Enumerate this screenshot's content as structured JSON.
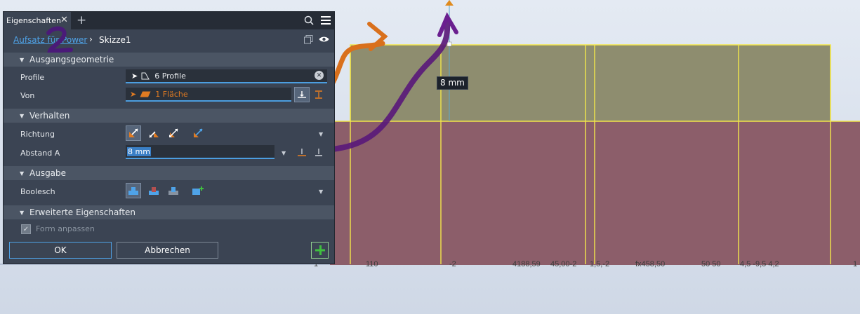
{
  "viewport": {
    "dimension_value": "8 mm",
    "ruler_labels": [
      "1",
      "110",
      "-2",
      "4188,59",
      "45,00-2",
      "1,5,-2",
      "fx458,50",
      "50 50",
      "4,5 -9,5 4,2",
      "1"
    ],
    "colors": {
      "top_block": "#8e8d6f",
      "lower_block": "#8c5e6a",
      "edge_yellow": "#f2e64a",
      "annotation_purple": "#5a1a7a",
      "annotation_orange": "#d9701c"
    },
    "annotations": {
      "number_mark": "2"
    }
  },
  "panel": {
    "tab_title": "Eigenschaften",
    "breadcrumb_link": "Aufsatz für Power",
    "breadcrumb_current": "Skizze1",
    "sections": {
      "source": "Ausgangsgeometrie",
      "behavior": "Verhalten",
      "output": "Ausgabe",
      "advanced": "Erweiterte Eigenschaften"
    },
    "profile": {
      "label": "Profile",
      "value": "6 Profile"
    },
    "from": {
      "label": "Von",
      "value": "1 Fläche"
    },
    "direction": {
      "label": "Richtung"
    },
    "distance": {
      "label": "Abstand A",
      "value": "8 mm"
    },
    "boolean": {
      "label": "Boolesch"
    },
    "fit_shape": {
      "label": "Form anpassen",
      "checked": true
    },
    "buttons": {
      "ok": "OK",
      "cancel": "Abbrechen"
    },
    "colors": {
      "accent": "#4fa3e8",
      "panel_bg": "#3b4453",
      "face_orange": "#e07b22",
      "add_green": "#3fbf3f"
    }
  }
}
